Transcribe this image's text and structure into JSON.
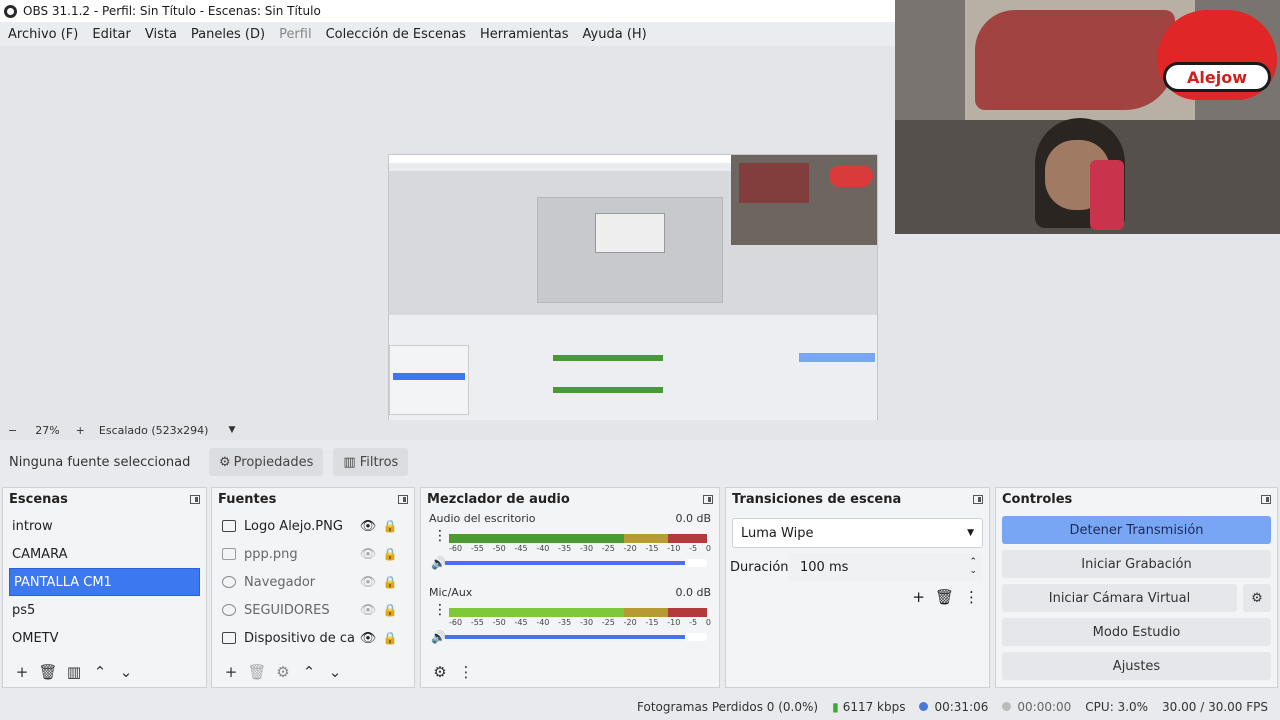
{
  "window": {
    "title": "OBS 31.1.2 - Perfil: Sin Título - Escenas: Sin Título"
  },
  "menu": [
    "Archivo (F)",
    "Editar",
    "Vista",
    "Paneles (D)",
    "Perfil",
    "Colección de Escenas",
    "Herramientas",
    "Ayuda (H)"
  ],
  "webcam_logo": "Alejow",
  "zoom": {
    "minus": "−",
    "value": "27%",
    "plus": "+",
    "scale": "Escalado (523x294)"
  },
  "source_toolbar": {
    "none_selected": "Ninguna fuente seleccionad",
    "properties": "Propiedades",
    "filters": "Filtros"
  },
  "scenes": {
    "title": "Escenas",
    "items": [
      "introw",
      "CAMARA",
      "PANTALLA CM1",
      "ps5",
      "OMETV"
    ],
    "selected": 2
  },
  "sources": {
    "title": "Fuentes",
    "items": [
      "Logo Alejo.PNG",
      "ppp.png",
      "Navegador",
      "SEGUIDORES",
      "Dispositivo de captu"
    ]
  },
  "mixer": {
    "title": "Mezclador de audio",
    "tracks": [
      {
        "name": "Audio del escritorio",
        "db": "0.0 dB"
      },
      {
        "name": "Mic/Aux",
        "db": "0.0 dB"
      }
    ],
    "scale": [
      "-60",
      "-55",
      "-50",
      "-45",
      "-40",
      "-35",
      "-30",
      "-25",
      "-20",
      "-15",
      "-10",
      "-5",
      "0"
    ]
  },
  "transitions": {
    "title": "Transiciones de escena",
    "selected": "Luma Wipe",
    "duration_label": "Duración",
    "duration_value": "100 ms"
  },
  "controls": {
    "title": "Controles",
    "stop_stream": "Detener Transmisión",
    "start_record": "Iniciar Grabación",
    "virtual_cam": "Iniciar Cámara Virtual",
    "studio_mode": "Modo Estudio",
    "settings": "Ajustes"
  },
  "status": {
    "dropped": "Fotogramas Perdidos 0 (0.0%)",
    "bitrate": "6117 kbps",
    "stream_time": "00:31:06",
    "record_time": "00:00:00",
    "cpu": "CPU: 3.0%",
    "fps": "30.00 / 30.00 FPS"
  },
  "colors": {
    "accent": "#3c78f0",
    "stream_active": "#78a6f5",
    "meter_green": "#4a9a34"
  }
}
